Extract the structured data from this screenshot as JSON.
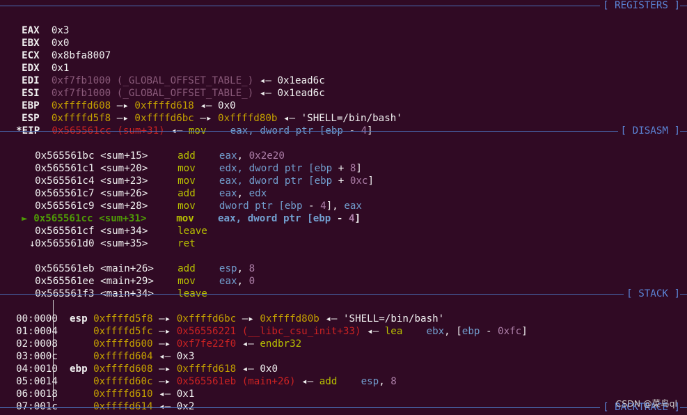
{
  "headers": {
    "registers": "[ REGISTERS ]",
    "disasm": "[ DISASM ]",
    "stack": "[ STACK ]",
    "backtrace": "[ BACKTRACE ]"
  },
  "arrow": "◂—",
  "colors": {
    "background": "#300a24",
    "header": "#5b84d6",
    "address_yellow": "#c4a000",
    "code_red": "#cc2222",
    "current_green": "#4e9a06",
    "mnemonic": "#b8c000",
    "register_blue": "#729fcf",
    "immediate_purple": "#ad7fa8"
  },
  "registers": {
    "eax": {
      "name": "EAX",
      "value": "0x3"
    },
    "ebx": {
      "name": "EBX",
      "value": "0x0"
    },
    "ecx": {
      "name": "ECX",
      "value": "0x8bfa8007"
    },
    "edx": {
      "name": "EDX",
      "value": "0x1"
    },
    "edi": {
      "name": "EDI",
      "addr": "0xf7fb1000",
      "symbol": "(_GLOBAL_OFFSET_TABLE_)",
      "value": "0x1ead6c"
    },
    "esi": {
      "name": "ESI",
      "addr": "0xf7fb1000",
      "symbol": "(_GLOBAL_OFFSET_TABLE_)",
      "value": "0x1ead6c"
    },
    "ebp": {
      "name": "EBP",
      "p1": "0xffffd608",
      "p2": "0xffffd618",
      "value": "0x0"
    },
    "esp": {
      "name": "ESP",
      "p1": "0xffffd5f8",
      "p2": "0xffffd6bc",
      "p3": "0xffffd80b",
      "value": "'SHELL=/bin/bash'"
    },
    "eip": {
      "name": "*EIP",
      "addr": "0x565561cc",
      "symbol": "(sum+31)",
      "mnem": "mov",
      "op1": "eax,",
      "op2a": "dword ptr [",
      "op2b": "ebp",
      "op2c": " - ",
      "op2d": "4",
      "op2e": "]"
    }
  },
  "disasm": [
    {
      "addr": "0x565561bc",
      "sym": "<sum+15>",
      "mnem": "add",
      "a": "eax",
      "b": ", ",
      "c": "0x2e20"
    },
    {
      "addr": "0x565561c1",
      "sym": "<sum+20>",
      "mnem": "mov",
      "a": "edx",
      "b": ", dword ptr [",
      "c": "ebp",
      "d": " + ",
      "e": "8",
      "f": "]"
    },
    {
      "addr": "0x565561c4",
      "sym": "<sum+23>",
      "mnem": "mov",
      "a": "eax",
      "b": ", dword ptr [",
      "c": "ebp",
      "d": " + ",
      "e": "0xc",
      "f": "]"
    },
    {
      "addr": "0x565561c7",
      "sym": "<sum+26>",
      "mnem": "add",
      "a": "eax",
      "b": ", ",
      "c": "edx"
    },
    {
      "addr": "0x565561c9",
      "sym": "<sum+28>",
      "mnem": "mov",
      "a": "dword ptr [",
      "b": "ebp",
      "c": " - ",
      "d": "4",
      "e": "], ",
      "f": "eax"
    },
    {
      "marker": "►",
      "addr": "0x565561cc",
      "sym": "<sum+31>",
      "mnem": "mov",
      "a": "eax",
      "b": ", dword ptr [",
      "c": "ebp",
      "d": " - ",
      "e": "4",
      "f": "]"
    },
    {
      "addr": "0x565561cf",
      "sym": "<sum+34>",
      "mnem": "leave"
    },
    {
      "addr": "0x565561d0",
      "sym": "<sum+35>",
      "mnem": "ret"
    },
    {
      "jump": "↓"
    },
    {
      "addr": "0x565561eb",
      "sym": "<main+26>",
      "mnem": "add",
      "a": "esp",
      "b": ", ",
      "c": "8"
    },
    {
      "addr": "0x565561ee",
      "sym": "<main+29>",
      "mnem": "mov",
      "a": "eax",
      "b": ", ",
      "c": "0"
    },
    {
      "addr": "0x565561f3",
      "sym": "<main+34>",
      "mnem": "leave"
    }
  ],
  "stack": [
    {
      "off": "00:0000",
      "reg": "esp",
      "addr": "0xffffd5f8",
      "v1": "0xffffd6bc",
      "v2": "0xffffd80b",
      "v3": "'SHELL=/bin/bash'"
    },
    {
      "off": "01:0004",
      "reg": "",
      "addr": "0xffffd5fc",
      "v1": "0x56556221",
      "sym": "(__libc_csu_init+33)",
      "mnem": "lea",
      "a": "ebx",
      "b": ", [",
      "c": "ebp",
      "d": " - ",
      "e": "0xfc",
      "f": "]"
    },
    {
      "off": "02:0008",
      "reg": "",
      "addr": "0xffffd600",
      "v1": "0xf7fe22f0",
      "mnem": "endbr32"
    },
    {
      "off": "03:000c",
      "reg": "",
      "addr": "0xffffd604",
      "v1": "0x3"
    },
    {
      "off": "04:0010",
      "reg": "ebp",
      "addr": "0xffffd608",
      "v1": "0xffffd618",
      "v2": "0x0"
    },
    {
      "off": "05:0014",
      "reg": "",
      "addr": "0xffffd60c",
      "v1": "0x565561eb",
      "sym": "(main+26)",
      "mnem": "add",
      "a": "esp",
      "b": ", ",
      "c": "8"
    },
    {
      "off": "06:0018",
      "reg": "",
      "addr": "0xffffd610",
      "v1": "0x1"
    },
    {
      "off": "07:001c",
      "reg": "",
      "addr": "0xffffd614",
      "v1": "0x2"
    }
  ],
  "watermark": "CSDN @菜鸟ql"
}
